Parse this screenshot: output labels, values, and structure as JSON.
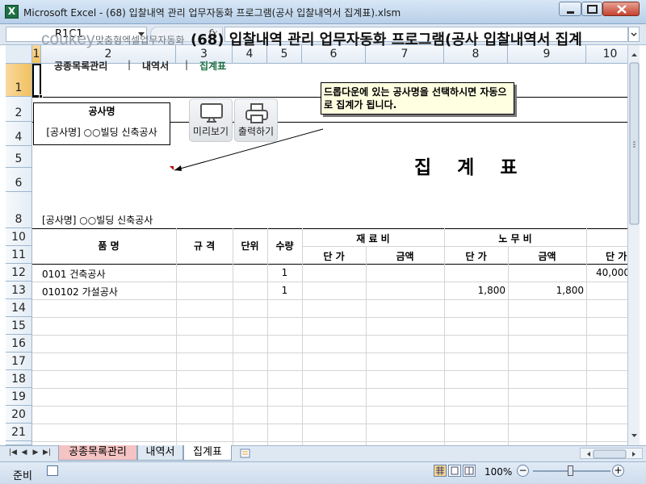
{
  "window": {
    "title": "Microsoft Excel - (68) 입찰내역 관리 업무자동화 프로그램(공사 입찰내역서 집계표).xlsm",
    "app_icon": "X"
  },
  "formula_bar": {
    "name_box": "R1C1",
    "fx": "fx",
    "value": ""
  },
  "columns": [
    "1",
    "2",
    "3",
    "4",
    "5",
    "6",
    "7",
    "8",
    "9",
    "10"
  ],
  "rows": [
    "1",
    "2",
    "4",
    "5",
    "6",
    "8",
    "10",
    "11",
    "12",
    "13",
    "14",
    "15",
    "16",
    "17",
    "18",
    "19",
    "20",
    "21"
  ],
  "sheet": {
    "brand": "coukey",
    "brand_sub": "맞춤형엑셀업무자동화",
    "program_title": "(68) 입찰내역 관리 업무자동화 프로그램(공사 입찰내역서 집계",
    "nav": {
      "item1": "공종목록관리",
      "item2": "내역서",
      "item3": "집계표",
      "sep": "|"
    },
    "callout": "드롭다운에 있는 공사명을 선택하시면 자동으로 집계가 됩니다.",
    "project_label": "공사명",
    "project_value": "[공사명] ○○빌딩 신축공사",
    "preview_button": "미리보기",
    "print_button": "출력하기",
    "summary_title": "집계표",
    "summary_subheader": "[공사명] ○○빌딩 신축공사",
    "table": {
      "h_name": "품 명",
      "h_spec": "규 격",
      "h_unit": "단위",
      "h_qty": "수량",
      "h_material": "재 료 비",
      "h_labor": "노 무 비",
      "h_unit_price": "단 가",
      "h_amount": "금액",
      "h_unit_price2": "단 가",
      "h_amount2": "금액",
      "h_unit_price3": "단 가",
      "rows": [
        {
          "name": "0101 건축공사",
          "qty": "1",
          "labor_unit": "",
          "labor_amount": "",
          "next_unit": "40,000"
        },
        {
          "name": "010102  가설공사",
          "qty": "1",
          "labor_unit": "1,800",
          "labor_amount": "1,800",
          "next_unit": ""
        }
      ]
    }
  },
  "tabs": [
    "공종목록관리",
    "내역서",
    "집계표"
  ],
  "status": {
    "ready": "준비",
    "zoom": "100%"
  },
  "colors": {
    "accent_link": "#1e7145",
    "tab_pink": "#f4c3c3",
    "header_sel": "#f1c15f"
  }
}
